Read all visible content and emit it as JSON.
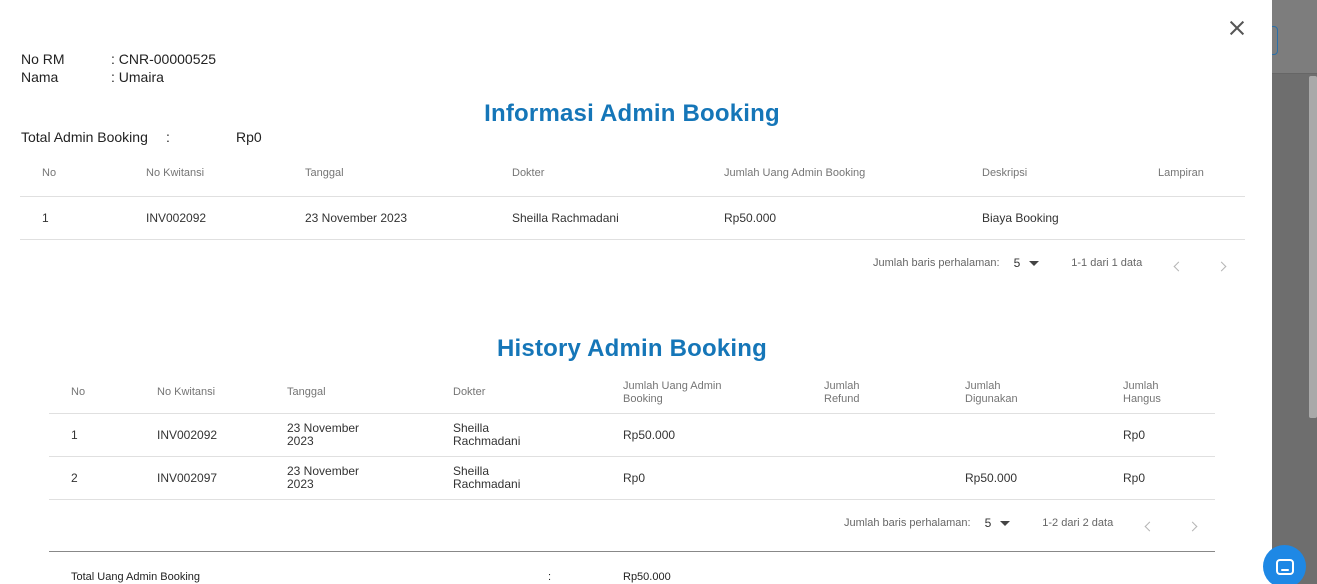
{
  "patient": {
    "rm_label": "No RM",
    "rm_value": ": CNR-00000525",
    "name_label": "Nama",
    "name_value": ": Umaira"
  },
  "info_section": {
    "title": "Informasi Admin Booking",
    "total_label": "Total Admin Booking",
    "total_sep": ":",
    "total_value": "Rp0",
    "columns": [
      "No",
      "No Kwitansi",
      "Tanggal",
      "Dokter",
      "Jumlah Uang Admin Booking",
      "Deskripsi",
      "Lampiran"
    ],
    "rows": [
      [
        "1",
        "INV002092",
        "23 November 2023",
        "Sheilla Rachmadani",
        "Rp50.000",
        "Biaya Booking",
        ""
      ]
    ],
    "pagination": {
      "rows_per_page_label": "Jumlah baris perhalaman:",
      "rows_per_page": "5",
      "range": "1-1 dari 1 data"
    }
  },
  "history_section": {
    "title": "History Admin Booking",
    "columns": [
      "No",
      "No Kwitansi",
      "Tanggal",
      "Dokter",
      "Jumlah Uang Admin Booking",
      "Jumlah Refund",
      "Jumlah Digunakan",
      "Jumlah Hangus"
    ],
    "rows": [
      [
        "1",
        "INV002092",
        "23 November 2023",
        "Sheilla Rachmadani",
        "Rp50.000",
        "",
        "",
        "Rp0"
      ],
      [
        "2",
        "INV002097",
        "23 November 2023",
        "Sheilla Rachmadani",
        "Rp0",
        "",
        "Rp50.000",
        "Rp0"
      ]
    ],
    "pagination": {
      "rows_per_page_label": "Jumlah baris perhalaman:",
      "rows_per_page": "5",
      "range": "1-2 dari 2 data"
    },
    "summary": {
      "label": "Total Uang Admin Booking",
      "sep": ":",
      "value": "Rp50.000"
    }
  },
  "icons": {
    "close": "close-icon",
    "prev": "chevron-left-icon",
    "next": "chevron-right-icon",
    "dropdown": "caret-down-icon",
    "chat": "chat-icon"
  },
  "colors": {
    "title": "#1576b8",
    "chat_button": "#1e88e5"
  }
}
